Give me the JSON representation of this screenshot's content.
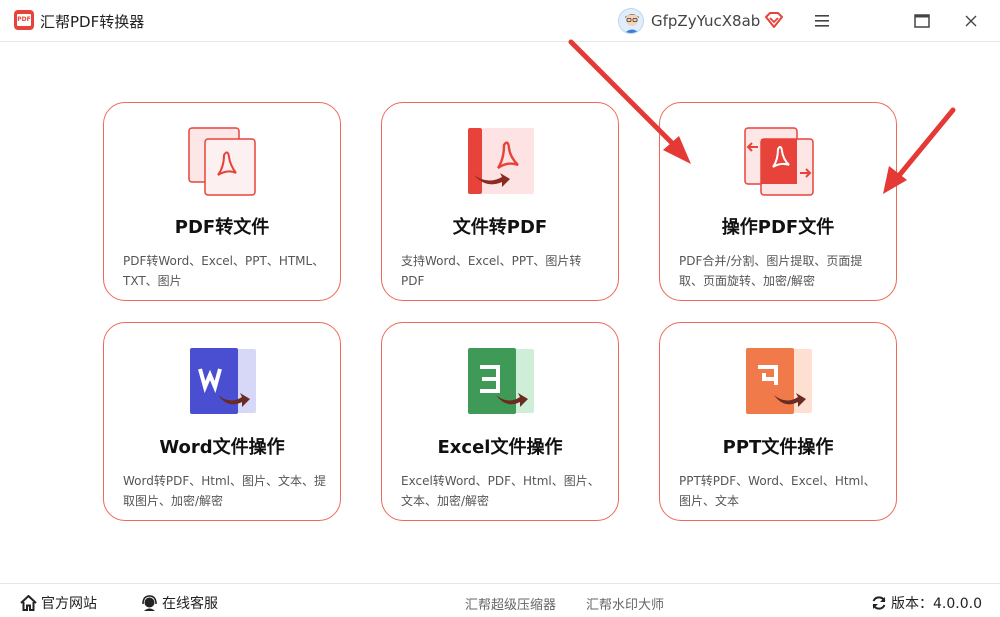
{
  "app": {
    "title": "汇帮PDF转换器",
    "logo_text": "PDF",
    "brand_color": "#e8433a"
  },
  "user": {
    "name": "GfpZyYucX8ab",
    "vip_icon": "diamond-icon"
  },
  "window_controls": [
    "menu-icon",
    "maximize-icon",
    "close-icon"
  ],
  "cards": [
    {
      "title": "PDF转文件",
      "desc": "PDF转Word、Excel、PPT、HTML、TXT、图片",
      "icon": "pdf-to-file-icon",
      "color": "#e8433a"
    },
    {
      "title": "文件转PDF",
      "desc": "支持Word、Excel、PPT、图片转PDF",
      "icon": "file-to-pdf-icon",
      "color": "#e8433a"
    },
    {
      "title": "操作PDF文件",
      "desc": "PDF合并/分割、图片提取、页面提取、页面旋转、加密/解密",
      "icon": "pdf-operate-icon",
      "color": "#e8433a"
    },
    {
      "title": "Word文件操作",
      "desc": "Word转PDF、Html、图片、文本、提取图片、加密/解密",
      "icon": "word-icon",
      "color": "#4a4fd1"
    },
    {
      "title": "Excel文件操作",
      "desc": "Excel转Word、PDF、Html、图片、文本、加密/解密",
      "icon": "excel-icon",
      "color": "#3f9a58"
    },
    {
      "title": "PPT文件操作",
      "desc": "PPT转PDF、Word、Excel、Html、图片、文本",
      "icon": "ppt-icon",
      "color": "#f07a4a"
    }
  ],
  "footer": {
    "website": "官方网站",
    "support": "在线客服",
    "link1": "汇帮超级压缩器",
    "link2": "汇帮水印大师",
    "version": "版本：4.0.0.0"
  },
  "colors": {
    "card_border": "#ec6a56",
    "arrow": "#e53935"
  }
}
